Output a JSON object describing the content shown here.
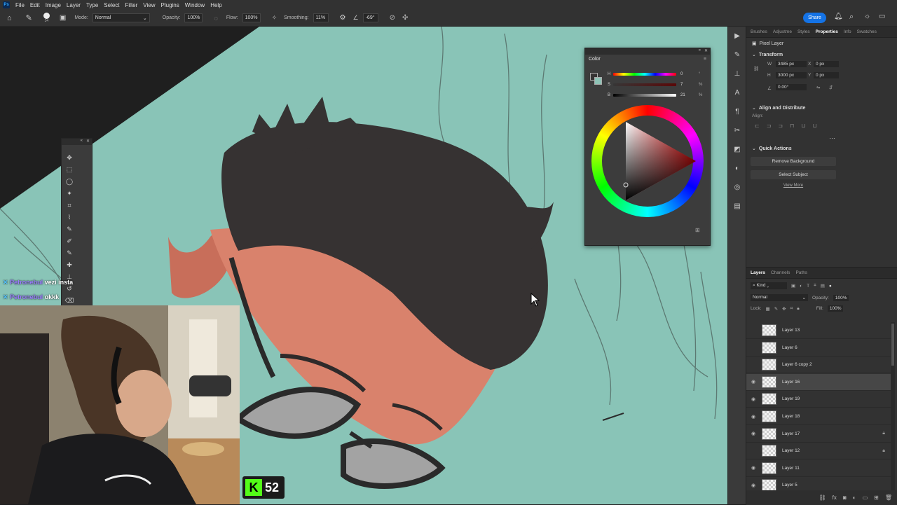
{
  "menubar": {
    "logo": "Ps",
    "items": [
      "File",
      "Edit",
      "Image",
      "Layer",
      "Type",
      "Select",
      "Filter",
      "View",
      "Plugins",
      "Window",
      "Help"
    ]
  },
  "options": {
    "brush_size": "34",
    "mode_label": "Mode:",
    "mode_value": "Normal",
    "opacity_label": "Opacity:",
    "opacity_value": "100%",
    "flow_label": "Flow:",
    "flow_value": "100%",
    "smoothing_label": "Smoothing:",
    "smoothing_value": "11%",
    "angle_value": "-69°"
  },
  "share_label": "Share",
  "right_tabs": [
    "Brushes",
    "Adjustme",
    "Styles",
    "Properties",
    "Info",
    "Swatches"
  ],
  "active_tab": "Properties",
  "properties": {
    "kind": "Pixel Layer",
    "transform_title": "Transform",
    "w_label": "W",
    "w_value": "3485 px",
    "h_label": "H",
    "h_value": "3000 px",
    "x_label": "X",
    "x_value": "0 px",
    "y_label": "Y",
    "y_value": "0 px",
    "angle": "0.00°",
    "align_title": "Align and Distribute",
    "align_label": "Align:",
    "quick_title": "Quick Actions",
    "remove_bg": "Remove Background",
    "select_subject": "Select Subject",
    "view_more": "View More"
  },
  "layers_panel": {
    "tabs": [
      "Layers",
      "Channels",
      "Paths"
    ],
    "filter": "Kind",
    "blend": "Normal",
    "opacity_label": "Opacity:",
    "opacity_value": "100%",
    "lock_label": "Lock:",
    "fill_label": "Fill:",
    "fill_value": "100%",
    "layers": [
      {
        "name": "Layer 13",
        "visible": false,
        "locked": false
      },
      {
        "name": "Layer 6",
        "visible": false,
        "locked": false
      },
      {
        "name": "Layer 6 copy 2",
        "visible": false,
        "locked": false
      },
      {
        "name": "Layer 16",
        "visible": true,
        "locked": false,
        "selected": true
      },
      {
        "name": "Layer 19",
        "visible": true,
        "locked": false
      },
      {
        "name": "Layer 18",
        "visible": true,
        "locked": false
      },
      {
        "name": "Layer 17",
        "visible": true,
        "locked": true
      },
      {
        "name": "Layer 12",
        "visible": false,
        "locked": true
      },
      {
        "name": "Layer 11",
        "visible": true,
        "locked": false
      },
      {
        "name": "Layer 5",
        "visible": true,
        "locked": false
      }
    ]
  },
  "color_panel": {
    "title": "Color",
    "h_label": "H",
    "h_value": "0",
    "h_unit": "°",
    "s_label": "S",
    "s_value": "7",
    "s_unit": "%",
    "b_label": "B",
    "b_value": "21",
    "b_unit": "%",
    "fg_color": "#363333",
    "bg_color": "#8ec3b6"
  },
  "chat": [
    {
      "user": "Petronebul",
      "msg": "vezi insta"
    },
    {
      "user": "Petronebul",
      "msg": "okkk"
    }
  ],
  "kick_badge": {
    "letter": "K",
    "count": "52"
  },
  "colors": {
    "canvas": "#89c4b7",
    "accent": "#1473e6",
    "panel": "#323232"
  }
}
